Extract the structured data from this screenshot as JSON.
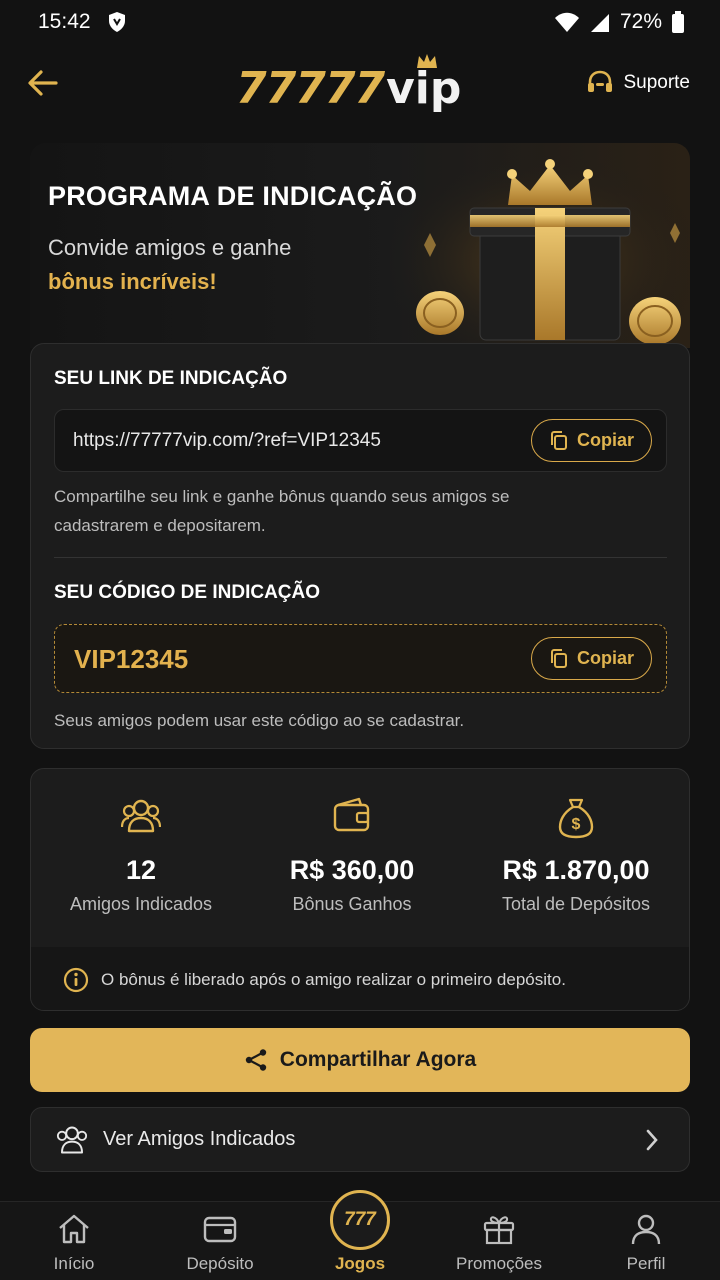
{
  "status": {
    "time": "15:42",
    "battery": "72%"
  },
  "header": {
    "logo_num": "77777",
    "logo_vip": "vip",
    "support": "Suporte"
  },
  "hero": {
    "title": "PROGRAMA DE INDICAÇÃO",
    "subtitle_line1": "Convide amigos e ganhe",
    "subtitle_line2": "bônus incríveis!"
  },
  "link_section": {
    "title": "SEU LINK DE INDICAÇÃO",
    "url": "https://77777vip.com/?ref=VIP12345",
    "copy_label": "Copiar",
    "desc_line1": "Compartilhe seu link e ganhe bônus quando seus amigos se",
    "desc_line2": "cadastrarem e depositarem."
  },
  "code_section": {
    "title": "SEU CÓDIGO DE INDICAÇÃO",
    "code": "VIP12345",
    "copy_label": "Copiar",
    "desc": "Seus amigos podem usar este código ao se cadastrar."
  },
  "stats": [
    {
      "value": "12",
      "label": "Amigos Indicados",
      "icon": "users-icon"
    },
    {
      "value": "R$ 360,00",
      "label": "Bônus Ganhos",
      "icon": "wallet-icon"
    },
    {
      "value": "R$ 1.870,00",
      "label": "Total de Depósitos",
      "icon": "money-bag-icon"
    }
  ],
  "stats_note": "O bônus é liberado após o amigo realizar o primeiro depósito.",
  "cta_label": "Compartilhar Agora",
  "friends_label": "Ver Amigos Indicados",
  "nav": {
    "items": [
      "Início",
      "Depósito",
      "Jogos",
      "Promoções",
      "Perfil"
    ],
    "center_badge": "777",
    "active": "Jogos"
  },
  "colors": {
    "accent": "#e0b450",
    "background": "#121212",
    "card": "#1c1c1c"
  }
}
